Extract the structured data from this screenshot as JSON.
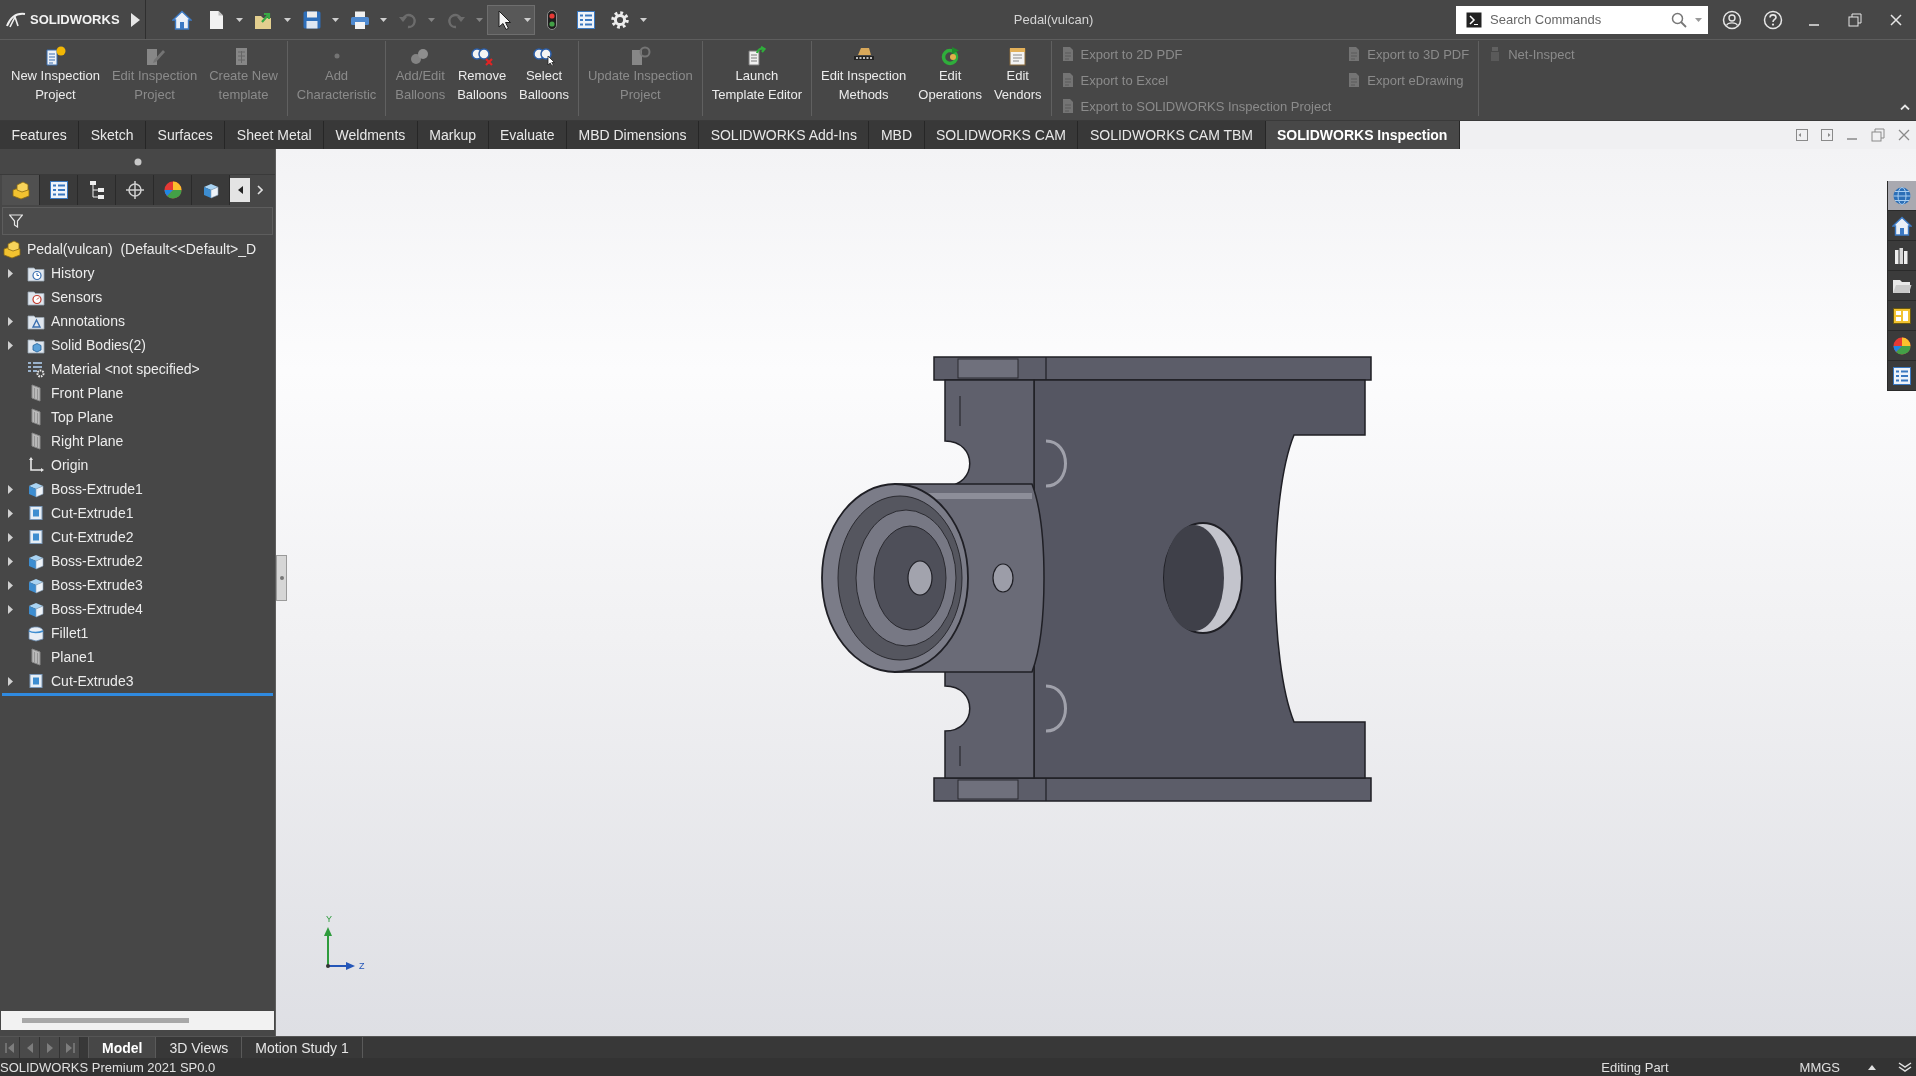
{
  "title_bar": {
    "logo": "**SOLID**WORKS",
    "quick_access": [
      {
        "dropdown": false,
        "disabled": false,
        "pressed": false
      },
      {
        "dropdown": true,
        "disabled": false,
        "pressed": false
      },
      {
        "dropdown": true,
        "disabled": false,
        "pressed": false
      },
      {
        "dropdown": true,
        "disabled": false,
        "pressed": false
      },
      {
        "dropdown": true,
        "disabled": false,
        "pressed": false
      },
      {
        "dropdown": true,
        "disabled": true,
        "pressed": false
      },
      {
        "dropdown": true,
        "disabled": true,
        "pressed": false
      },
      {
        "dropdown": true,
        "disabled": false,
        "pressed": true
      },
      {
        "dropdown": false,
        "disabled": false,
        "pressed": false
      },
      {
        "dropdown": false,
        "disabled": false,
        "pressed": false
      },
      {
        "dropdown": true,
        "disabled": false,
        "pressed": false
      }
    ],
    "document_title": "Pedal(vulcan)",
    "search": {
      "placeholder": "Search Commands"
    }
  },
  "ribbon": {
    "groups": [
      {
        "kind": "large",
        "buttons": [
          {
            "label": "New Inspection\nProject",
            "disabled": false
          },
          {
            "label": "Edit Inspection\nProject",
            "disabled": true
          },
          {
            "label": "Create New\ntemplate",
            "disabled": true
          }
        ]
      },
      {
        "kind": "large",
        "buttons": [
          {
            "label": "Add\nCharacteristic",
            "disabled": true
          }
        ]
      },
      {
        "kind": "large",
        "buttons": [
          {
            "label": "Add/Edit\nBalloons",
            "disabled": true
          },
          {
            "label": "Remove\nBalloons",
            "disabled": false
          },
          {
            "label": "Select\nBalloons",
            "disabled": false
          }
        ]
      },
      {
        "kind": "large",
        "buttons": [
          {
            "label": "Update Inspection\nProject",
            "disabled": true
          }
        ]
      },
      {
        "kind": "large",
        "buttons": [
          {
            "label": "Launch\nTemplate Editor",
            "disabled": false
          }
        ]
      },
      {
        "kind": "large",
        "buttons": [
          {
            "label": "Edit Inspection\nMethods",
            "disabled": false
          },
          {
            "label": "Edit\nOperations",
            "disabled": false
          },
          {
            "label": "Edit\nVendors",
            "disabled": false
          }
        ]
      },
      {
        "kind": "small",
        "columns": [
          [
            {
              "label": "Export to 2D PDF",
              "disabled": true
            },
            {
              "label": "Export to Excel",
              "disabled": true
            },
            {
              "label": "Export to SOLIDWORKS Inspection Project",
              "disabled": true
            }
          ],
          [
            {
              "label": "Export to 3D PDF",
              "disabled": true
            },
            {
              "label": "Export eDrawing",
              "disabled": true
            }
          ]
        ]
      },
      {
        "kind": "small",
        "columns": [
          [
            {
              "label": "Net-Inspect",
              "disabled": true
            }
          ]
        ]
      }
    ]
  },
  "command_tabs": [
    {
      "label": "Features",
      "selected": false
    },
    {
      "label": "Sketch",
      "selected": false
    },
    {
      "label": "Surfaces",
      "selected": false
    },
    {
      "label": "Sheet Metal",
      "selected": false
    },
    {
      "label": "Weldments",
      "selected": false
    },
    {
      "label": "Markup",
      "selected": false
    },
    {
      "label": "Evaluate",
      "selected": false
    },
    {
      "label": "MBD Dimensions",
      "selected": false
    },
    {
      "label": "SOLIDWORKS Add-Ins",
      "selected": false
    },
    {
      "label": "MBD",
      "selected": false
    },
    {
      "label": "SOLIDWORKS CAM",
      "selected": false
    },
    {
      "label": "SOLIDWORKS CAM TBM",
      "selected": false
    },
    {
      "label": "SOLIDWORKS Inspection",
      "selected": true
    }
  ],
  "feature_manager": {
    "tabs": [
      {
        "selected": true
      },
      {
        "selected": false
      },
      {
        "selected": false
      },
      {
        "selected": false
      },
      {
        "selected": false
      },
      {
        "selected": false
      }
    ],
    "tree": {
      "label": "Pedal(vulcan)  (Default<<Default>_D",
      "children": [
        {
          "label": "History",
          "expanded": false
        },
        {
          "label": "Sensors"
        },
        {
          "label": "Annotations",
          "expanded": false
        },
        {
          "label": "Solid Bodies(2)",
          "expanded": false
        },
        {
          "label": "Material <not specified>"
        },
        {
          "label": "Front Plane"
        },
        {
          "label": "Top Plane"
        },
        {
          "label": "Right Plane"
        },
        {
          "label": "Origin"
        },
        {
          "label": "Boss-Extrude1",
          "expanded": false
        },
        {
          "label": "Cut-Extrude1",
          "expanded": false
        },
        {
          "label": "Cut-Extrude2",
          "expanded": false
        },
        {
          "label": "Boss-Extrude2",
          "expanded": false
        },
        {
          "label": "Boss-Extrude3",
          "expanded": false
        },
        {
          "label": "Boss-Extrude4",
          "expanded": false
        },
        {
          "label": "Fillet1"
        },
        {
          "label": "Plane1"
        },
        {
          "label": "Cut-Extrude3",
          "expanded": false
        }
      ]
    }
  },
  "graphics": {
    "triad": {
      "y_label": "Y",
      "z_label": "Z"
    },
    "task_pane": [
      {
        "selected": true
      },
      {
        "selected": false
      },
      {
        "selected": false
      },
      {
        "selected": false
      },
      {
        "selected": false
      },
      {
        "selected": false
      },
      {
        "selected": false
      }
    ]
  },
  "bottom_tabs": {
    "nav": [
      {
        "disabled": true
      },
      {
        "disabled": true
      },
      {
        "disabled": true
      },
      {
        "disabled": true
      }
    ],
    "tabs": [
      {
        "label": "Model",
        "selected": true
      },
      {
        "label": "3D Views",
        "selected": false
      },
      {
        "label": "Motion Study 1",
        "selected": false
      }
    ]
  },
  "status_bar": {
    "product": "SOLIDWORKS Premium 2021 SP0.0",
    "mode": "Editing Part",
    "units": "MMGS"
  }
}
